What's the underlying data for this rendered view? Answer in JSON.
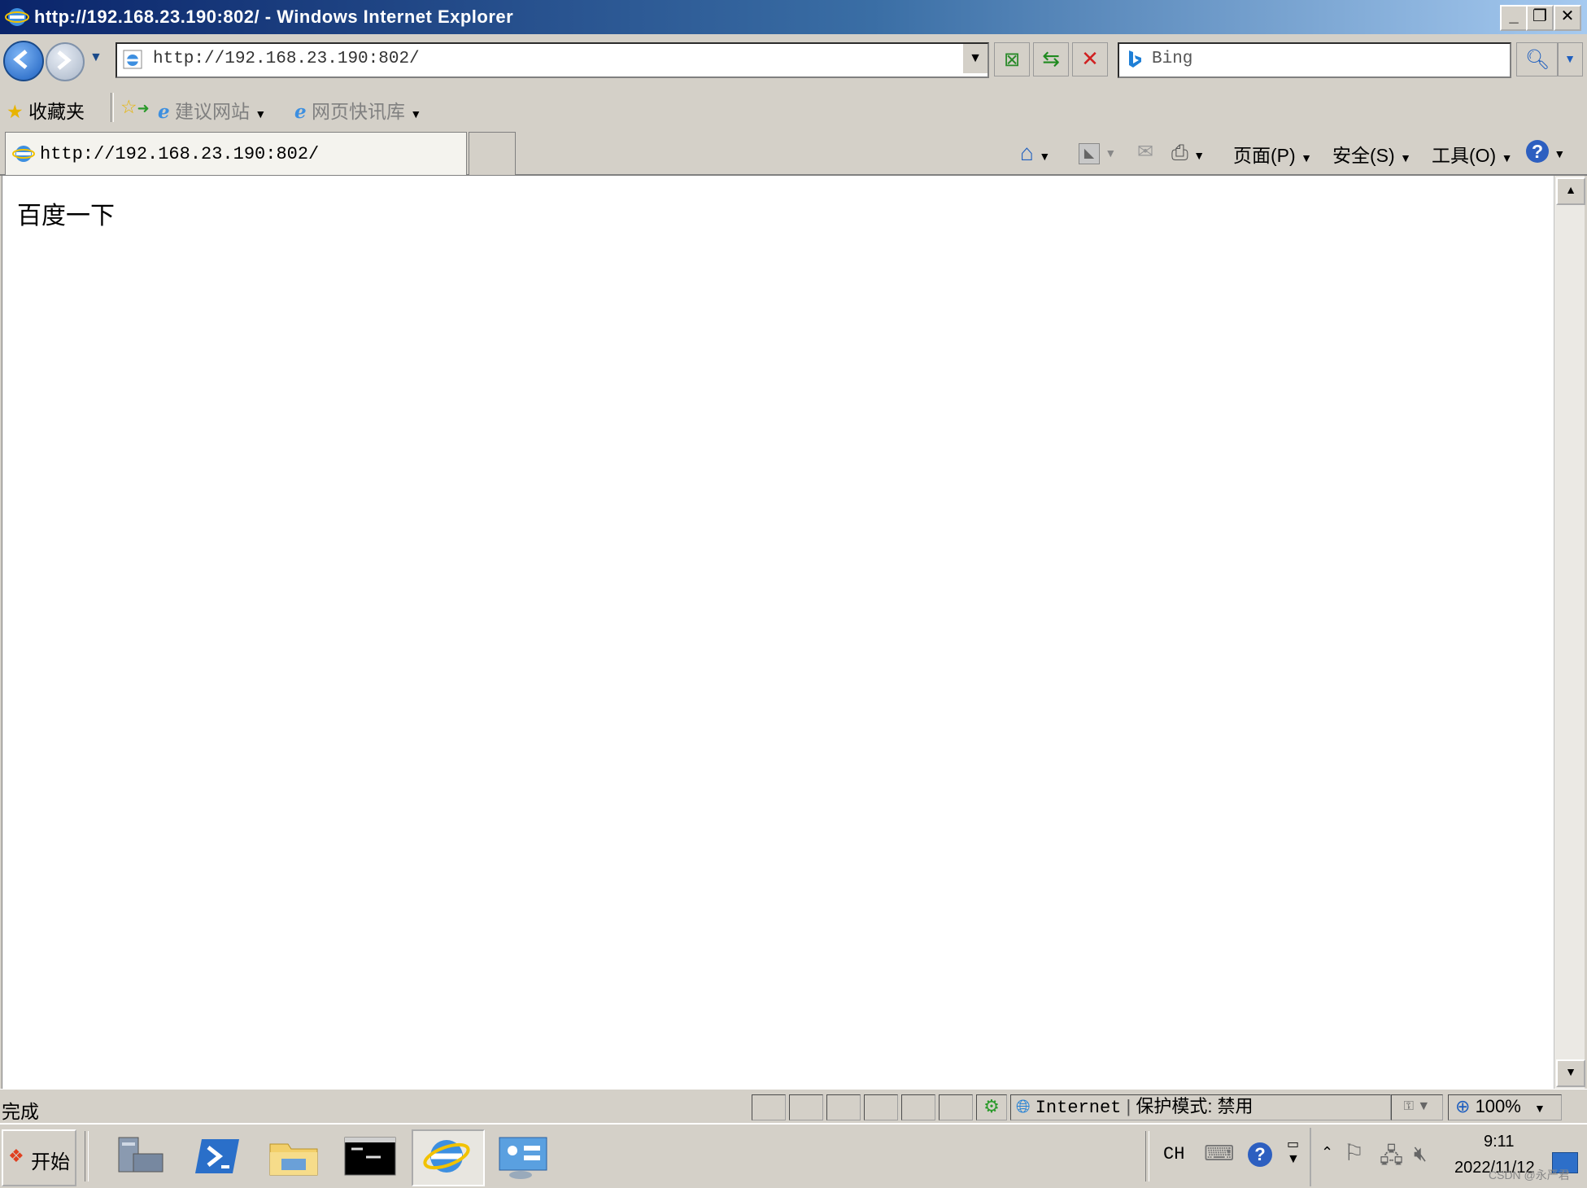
{
  "window": {
    "title": "http://192.168.23.190:802/ - Windows Internet Explorer"
  },
  "nav": {
    "address": "http://192.168.23.190:802/",
    "search_placeholder": "Bing"
  },
  "favorites": {
    "label": "收藏夹",
    "items": [
      "建议网站",
      "网页快讯库"
    ]
  },
  "tabs": [
    {
      "label": "http://192.168.23.190:802/"
    }
  ],
  "commands": {
    "page": "页面(P)",
    "safety": "安全(S)",
    "tools": "工具(O)"
  },
  "page": {
    "text": "百度一下"
  },
  "status": {
    "text": "完成",
    "zone": "Internet",
    "protected_mode": "保护模式: 禁用",
    "zoom": "100%"
  },
  "taskbar": {
    "start": "开始",
    "lang": "CH",
    "time": "9:11",
    "date": "2022/11/12",
    "watermark": "CSDN @永严君"
  },
  "icons": [
    "ie-icon",
    "back-icon",
    "forward-icon",
    "refresh-icon",
    "stop-icon",
    "compat-icon",
    "search-icon",
    "star-icon",
    "home-icon",
    "feeds-icon",
    "mail-icon",
    "print-icon",
    "help-icon",
    "globe-icon"
  ]
}
